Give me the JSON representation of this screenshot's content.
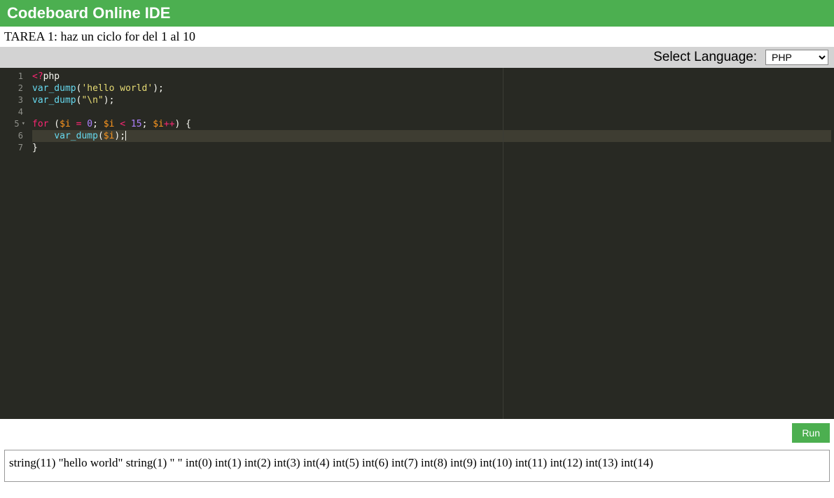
{
  "header": {
    "title": "Codeboard Online IDE"
  },
  "task": {
    "text": "TAREA 1: haz un ciclo for del 1 al 10"
  },
  "toolbar": {
    "language_label": "Select Language:",
    "language_selected": "PHP"
  },
  "editor": {
    "lines": [
      {
        "num": "1",
        "fold": ""
      },
      {
        "num": "2",
        "fold": ""
      },
      {
        "num": "3",
        "fold": ""
      },
      {
        "num": "4",
        "fold": ""
      },
      {
        "num": "5",
        "fold": "▾"
      },
      {
        "num": "6",
        "fold": ""
      },
      {
        "num": "7",
        "fold": ""
      }
    ],
    "code": {
      "l1": {
        "a": "<?",
        "b": "php"
      },
      "l2": {
        "a": "var_dump",
        "b": "(",
        "c": "'hello world'",
        "d": ");"
      },
      "l3": {
        "a": "var_dump",
        "b": "(",
        "c": "\"\\n\"",
        "d": ");"
      },
      "l4": "",
      "l5": {
        "a": "for",
        "b": " (",
        "c": "$i",
        "d": " ",
        "e": "=",
        "f": " ",
        "g": "0",
        "h": "; ",
        "i": "$i",
        "j": " ",
        "k": "<",
        "l": " ",
        "m": "15",
        "n": "; ",
        "o": "$i",
        "p": "++",
        "q": ") {"
      },
      "l6": {
        "a": "    ",
        "b": "var_dump",
        "c": "(",
        "d": "$i",
        "e": ");"
      },
      "l7": "}"
    }
  },
  "run": {
    "label": "Run"
  },
  "output": {
    "text": "string(11) \"hello world\" string(1) \" \" int(0) int(1) int(2) int(3) int(4) int(5) int(6) int(7) int(8) int(9) int(10) int(11) int(12) int(13) int(14)"
  }
}
